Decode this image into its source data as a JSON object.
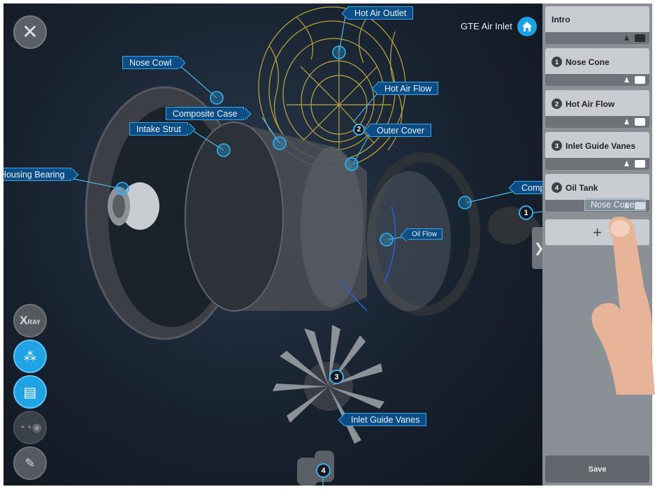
{
  "header": {
    "title": "GTE Air Inlet"
  },
  "labels": {
    "nose_cowl": "Nose Cowl",
    "composite_case": "Composite Case",
    "intake_strut": "Intake Strut",
    "housing_bearing": "Housing Bearing",
    "hot_air_outlet": "Hot Air Outlet",
    "hot_air_flow": "Hot Air Flow",
    "outer_cover": "Outer Cover",
    "compressor": "Compressor",
    "oil_flow": "Oil Flow",
    "inlet_guide_vanes": "Inlet Guide Vanes",
    "nose_cone_drag": "Nose Cone"
  },
  "markers": [
    "1",
    "2",
    "3",
    "4"
  ],
  "toolbar": {
    "xray": "RAY"
  },
  "sidebar": {
    "cards": [
      {
        "num": "",
        "label": "Intro"
      },
      {
        "num": "1",
        "label": "Nose Cone"
      },
      {
        "num": "2",
        "label": "Hot Air Flow"
      },
      {
        "num": "3",
        "label": "Inlet Guide Vanes"
      },
      {
        "num": "4",
        "label": "Oil Tank"
      }
    ],
    "add_label": "+",
    "save_label": "Save"
  },
  "colors": {
    "accent": "#1fa3e4",
    "label_bg": "#0b4d84",
    "wireframe": "#e6c94a"
  }
}
